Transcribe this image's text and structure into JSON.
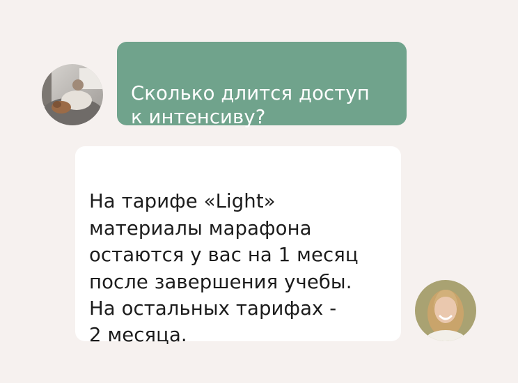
{
  "chat": {
    "messages": [
      {
        "role": "user",
        "text": "Сколько длится доступ\nк интенсиву?"
      },
      {
        "role": "support",
        "text": "На тарифе «Light»\nматериалы марафона\nостаются у вас на 1 месяц\nпосле завершения учебы.\nНа остальных тарифах -\n2 месяца."
      }
    ]
  },
  "colors": {
    "background": "#f6f1ef",
    "question_bubble": "#70a38c",
    "answer_bubble": "#ffffff",
    "answer_text": "#1c1c1c"
  },
  "icons": {
    "user_avatar": "user-photo-avatar",
    "support_avatar": "support-photo-avatar"
  }
}
